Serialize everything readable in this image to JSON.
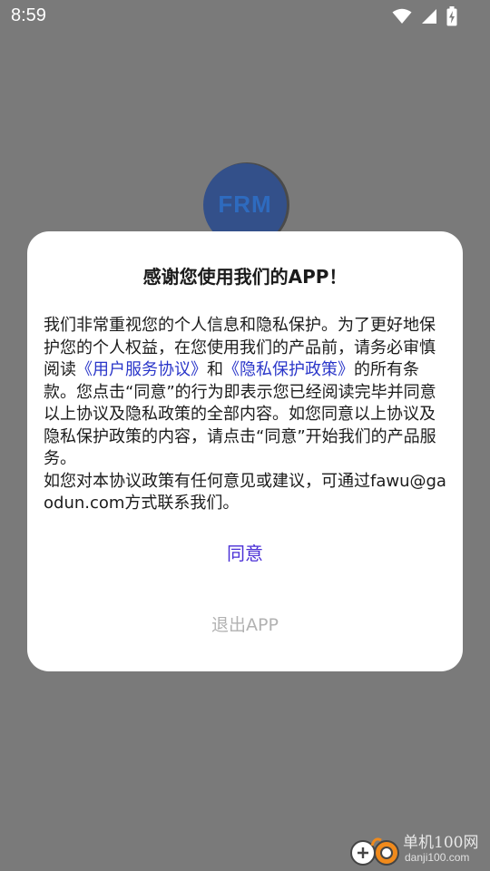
{
  "status_bar": {
    "time": "8:59"
  },
  "logo": {
    "text": "FRM"
  },
  "dialog": {
    "title": "感谢您使用我们的APP！",
    "body": {
      "part1": "我们非常重视您的个人信息和隐私保护。为了更好地保护您的个人权益，在您使用我们的产品前，请务必审慎阅读",
      "link_service": "《用户服务协议》",
      "part2": "和",
      "link_privacy": "《隐私保护政策》",
      "part3": "的所有条款。您点击“同意”的行为即表示您已经阅读完毕并同意以上协议及隐私政策的全部内容。如您同意以上协议及隐私保护政策的内容，请点击“同意”开始我们的产品服务。",
      "part4": "如您对本协议政策有任何意见或建议，可通过fawu@gaodun.com方式联系我们。"
    },
    "agree_label": "同意",
    "exit_label": "退出APP"
  },
  "watermark": {
    "title": "单机100网",
    "url": "danji100.com"
  },
  "colors": {
    "scrim": "#7a7a7a",
    "link": "#2a36c9",
    "agree": "#4a2fd6",
    "exit": "#b2b2b2"
  }
}
